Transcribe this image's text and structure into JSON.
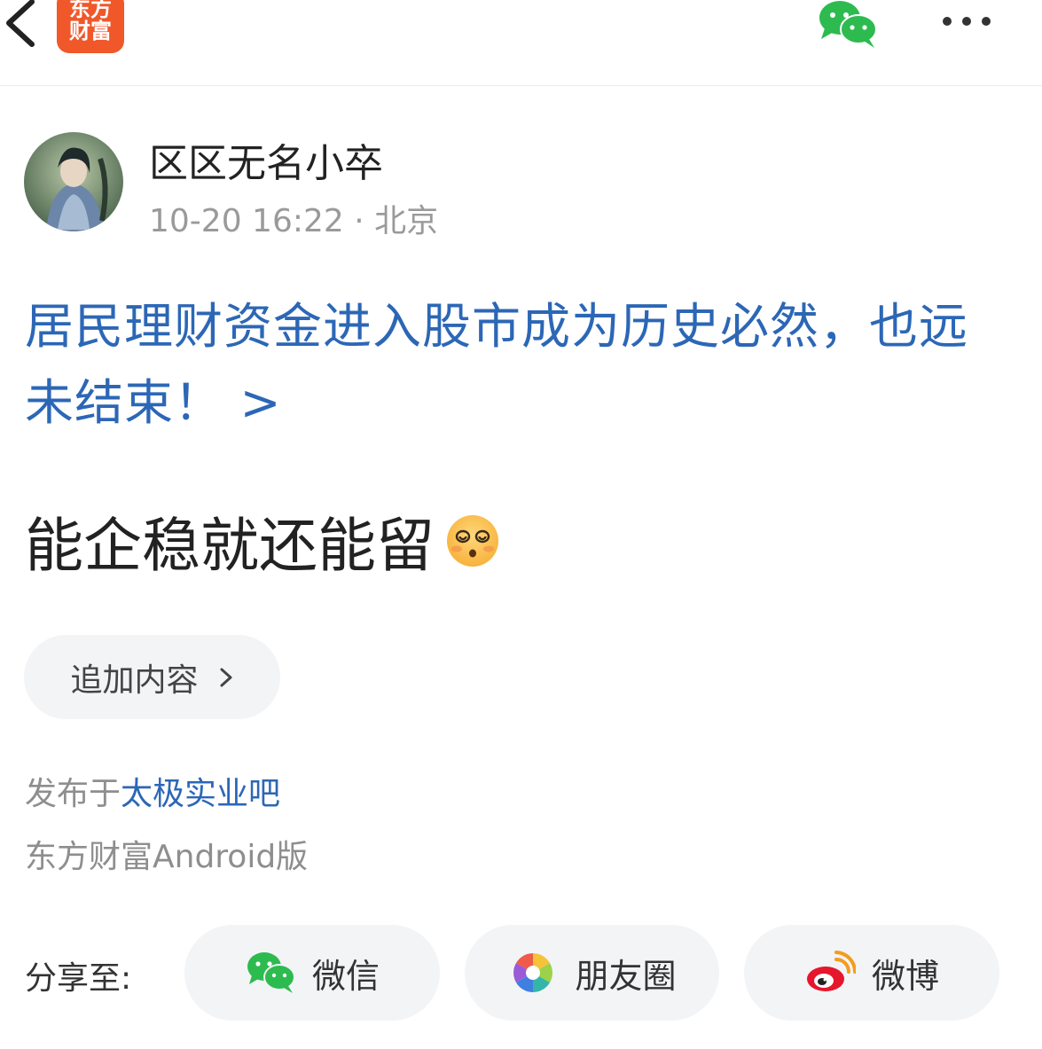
{
  "header": {
    "logo_line1": "东方",
    "logo_line2": "财富",
    "back_icon": "chevron-left-icon",
    "share_icon": "wechat-icon",
    "more_icon": "more-dots-icon",
    "brand_color": "#f0582a"
  },
  "post": {
    "author": "区区无名小卒",
    "meta": "10-20 16:22 · 北京",
    "title": "居民理财资金进入股市成为历史必然，也远未结束！ >",
    "body": "能企稳就还能留",
    "body_emoji": "dizzy-face-emoji",
    "link_color": "#2c67b6"
  },
  "actions": {
    "add_content_label": "追加内容"
  },
  "footer": {
    "posted_prefix": "发布于",
    "board_name": "太极实业吧",
    "client": "东方财富Android版"
  },
  "share": {
    "label": "分享至:",
    "wechat": "微信",
    "moments": "朋友圈",
    "weibo": "微博"
  }
}
